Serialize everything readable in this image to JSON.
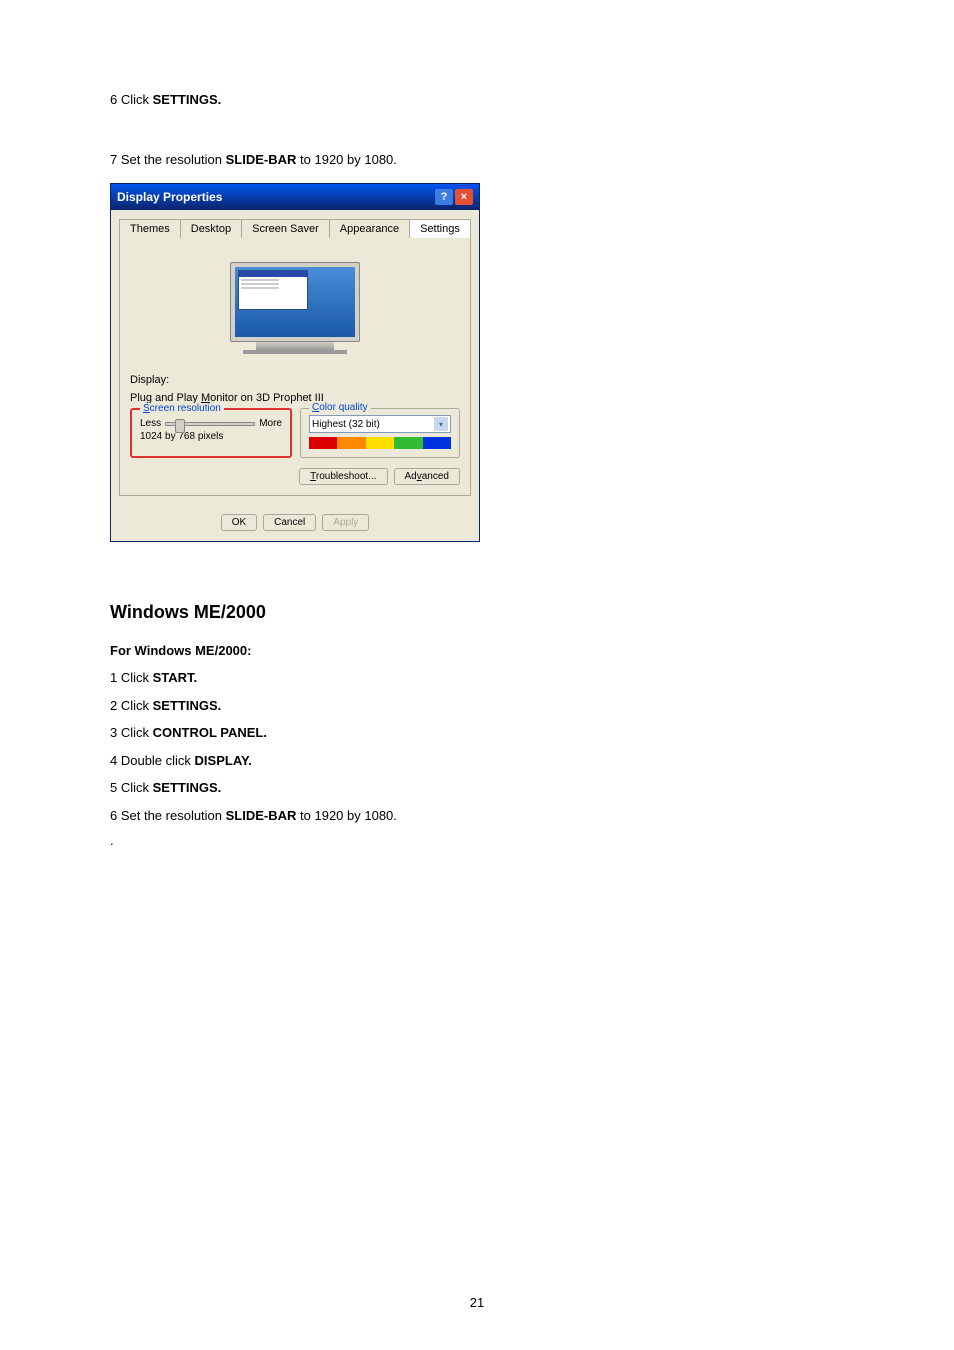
{
  "top_section": {
    "step6_num": "6 Click ",
    "step6_bold": "SETTINGS.",
    "step7_pre": "7 Set the resolution ",
    "step7_bold": "SLIDE-BAR",
    "step7_post": " to 1920 by 1080."
  },
  "dialog": {
    "title": "Display Properties",
    "help": "?",
    "close": "×",
    "tabs": {
      "themes": "Themes",
      "desktop": "Desktop",
      "screensaver": "Screen Saver",
      "appearance": "Appearance",
      "settings": "Settings"
    },
    "display_label": "Display:",
    "display_name_pre": "Plug and Play ",
    "display_name_u": "M",
    "display_name_post": "onitor on 3D Prophet III",
    "resolution_legend_u": "S",
    "resolution_legend": "creen resolution",
    "less": "Less",
    "more": "More",
    "resolution_value": "1024 by 768 pixels",
    "quality_legend_u": "C",
    "quality_legend": "olor quality",
    "quality_value": "Highest (32 bit)",
    "troubleshoot_u": "T",
    "troubleshoot": "roubleshoot...",
    "advanced_pre": "Ad",
    "advanced_u": "v",
    "advanced_post": "anced",
    "ok": "OK",
    "cancel": "Cancel",
    "apply": "Apply"
  },
  "me2000": {
    "title": "Windows ME/2000",
    "subheading": "For Windows ME/2000:",
    "s1_pre": "1 Click ",
    "s1_bold": "START.",
    "s2_pre": "2 Click ",
    "s2_bold": "SETTINGS.",
    "s3_pre": "3 Click ",
    "s3_bold": "CONTROL PANEL.",
    "s4_pre": "4 Double click ",
    "s4_bold": "DISPLAY.",
    "s5_pre": "5 Click ",
    "s5_bold": "SETTINGS.",
    "s6_pre": "6 Set the resolution ",
    "s6_bold": "SLIDE-BAR",
    "s6_post": " to 1920 by 1080.",
    "dot": "."
  },
  "page_number": "21"
}
